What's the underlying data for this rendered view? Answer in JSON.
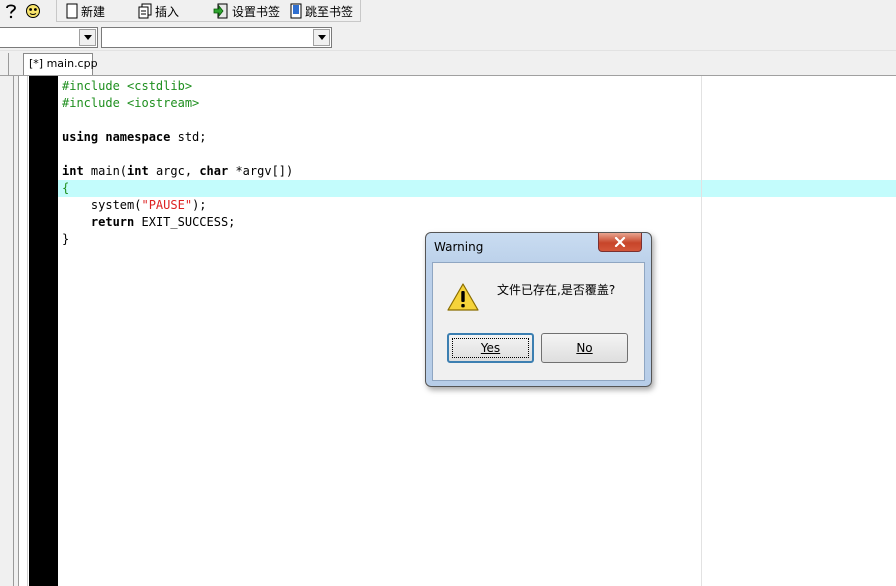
{
  "toolbar": {
    "new_label": "新建",
    "insert_label": "插入",
    "set_bookmark_label": "设置书签",
    "goto_bookmark_label": "跳至书签"
  },
  "combos": {
    "class_value": "",
    "member_value": ""
  },
  "tabs": [
    {
      "label": "[*] main.cpp"
    }
  ],
  "editor": {
    "lines": [
      "#include <cstdlib>",
      "#include <iostream>",
      "",
      "using namespace std;",
      "",
      "int main(int argc, char *argv[])",
      "{",
      "    system(\"PAUSE\");",
      "    return EXIT_SUCCESS;",
      "}"
    ],
    "highlight_color": "#c3fcfc"
  },
  "dialog": {
    "title": "Warning",
    "message": "文件已存在,是否覆盖?",
    "yes_label": "Yes",
    "no_label": "No",
    "icon": "warning-icon"
  }
}
